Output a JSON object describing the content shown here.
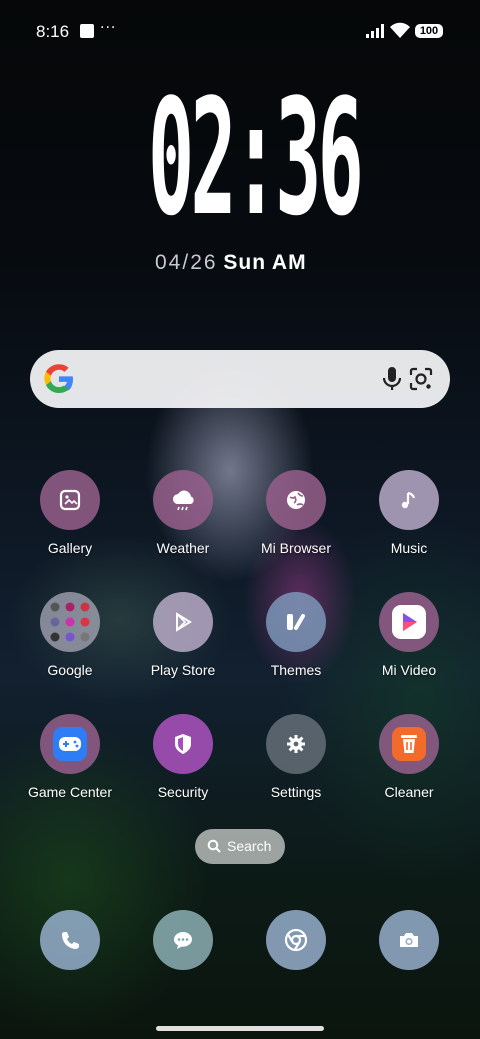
{
  "status_bar": {
    "time": "8:16",
    "more": "···",
    "battery": "100"
  },
  "lock_clock": {
    "time": "02:36",
    "date": "04/26",
    "weekday": "Sun",
    "ampm": "AM"
  },
  "search_bar": {
    "brand_icon": "google-g-icon",
    "voice_icon": "mic-icon",
    "lens_icon": "lens-icon"
  },
  "apps": [
    {
      "label": "Gallery",
      "icon": "gallery-icon"
    },
    {
      "label": "Weather",
      "icon": "weather-icon"
    },
    {
      "label": "Mi Browser",
      "icon": "globe-icon"
    },
    {
      "label": "Music",
      "icon": "music-note-icon"
    },
    {
      "label": "Google",
      "icon": "folder-icon"
    },
    {
      "label": "Play Store",
      "icon": "play-store-icon"
    },
    {
      "label": "Themes",
      "icon": "themes-icon"
    },
    {
      "label": "Mi Video",
      "icon": "video-play-icon"
    },
    {
      "label": "Game Center",
      "icon": "gamepad-icon"
    },
    {
      "label": "Security",
      "icon": "shield-icon"
    },
    {
      "label": "Settings",
      "icon": "gear-icon"
    },
    {
      "label": "Cleaner",
      "icon": "trash-icon"
    }
  ],
  "app_search": {
    "label": "Search"
  },
  "dock": [
    {
      "icon": "phone-icon"
    },
    {
      "icon": "message-icon"
    },
    {
      "icon": "chrome-icon"
    },
    {
      "icon": "camera-icon"
    }
  ]
}
